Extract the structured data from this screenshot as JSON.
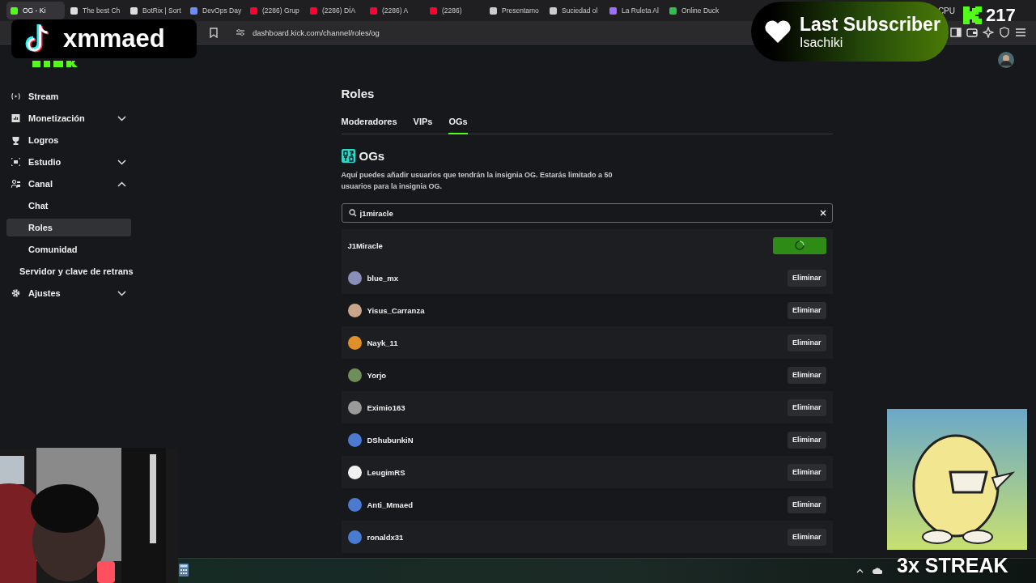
{
  "browser": {
    "tabs": [
      {
        "title": "OG - Ki",
        "selected": true,
        "color": "#53fc18"
      },
      {
        "title": "The best Ch",
        "selected": false,
        "color": "#dddddd"
      },
      {
        "title": "BotRix | Sort",
        "selected": false,
        "color": "#dddddd"
      },
      {
        "title": "DevOps Day",
        "selected": false,
        "color": "#6b8cff"
      },
      {
        "title": "(2286) Grup",
        "selected": false,
        "color": "#ff0033"
      },
      {
        "title": "(2286) DÍA",
        "selected": false,
        "color": "#ff0033"
      },
      {
        "title": "(2286) A",
        "selected": false,
        "color": "#ff0033"
      },
      {
        "title": "(2286)",
        "selected": false,
        "color": "#ff0033"
      },
      {
        "title": "Presentamo",
        "selected": false,
        "color": "#cccccc"
      },
      {
        "title": "Suciedad ol",
        "selected": false,
        "color": "#cccccc"
      },
      {
        "title": "La Ruleta Al",
        "selected": false,
        "color": "#a06bff"
      },
      {
        "title": "Online Duck",
        "selected": false,
        "color": "#2fbf4f"
      }
    ],
    "url": "dashboard.kick.com/channel/roles/og",
    "cpu": "CPU"
  },
  "sidebar": {
    "items": [
      {
        "label": "Stream",
        "kind": "link",
        "selected": false
      },
      {
        "label": "Monetización",
        "kind": "group",
        "expanded": false,
        "selected": false
      },
      {
        "label": "Logros",
        "kind": "link",
        "selected": false
      },
      {
        "label": "Estudio",
        "kind": "group",
        "expanded": false,
        "selected": false
      },
      {
        "label": "Canal",
        "kind": "group",
        "expanded": true,
        "selected": false,
        "children": [
          {
            "label": "Chat",
            "kind": "sub",
            "selected": false
          },
          {
            "label": "Roles",
            "kind": "sub",
            "selected": true
          },
          {
            "label": "Comunidad",
            "kind": "sub",
            "selected": false
          }
        ]
      },
      {
        "label": "Servidor y clave de retrans",
        "kind": "plain",
        "selected": false
      },
      {
        "label": "Ajustes",
        "kind": "group",
        "expanded": false,
        "selected": false
      }
    ]
  },
  "page": {
    "title": "Roles",
    "tabs": [
      {
        "label": "Moderadores",
        "selected": false
      },
      {
        "label": "VIPs",
        "selected": false
      },
      {
        "label": "OGs",
        "selected": true
      }
    ],
    "section_title": "OGs",
    "description": "Aquí puedes añadir usuarios que tendrán la insignia OG. Estarás limitado a 50 usuarios para la insignia OG.",
    "search": {
      "value": "j1miracle"
    },
    "result": {
      "name": "J1Miracle",
      "loading": true
    },
    "members": [
      {
        "name": "blue_mx",
        "color": "#8a8fb8",
        "action": "Eliminar"
      },
      {
        "name": "Yisus_Carranza",
        "color": "#c9a58a",
        "action": "Eliminar"
      },
      {
        "name": "Nayk_11",
        "color": "#e0902a",
        "action": "Eliminar"
      },
      {
        "name": "Yorjo",
        "color": "#6f8f5a",
        "action": "Eliminar"
      },
      {
        "name": "Eximio163",
        "color": "#9a9a9a",
        "action": "Eliminar"
      },
      {
        "name": "DShubunkiN",
        "color": "#4a7bd0",
        "action": "Eliminar"
      },
      {
        "name": "LeugimRS",
        "color": "#f2f2f2",
        "action": "Eliminar"
      },
      {
        "name": "Anti_Mmaed",
        "color": "#4a7bd0",
        "action": "Eliminar"
      },
      {
        "name": "ronaldx31",
        "color": "#4a7bd0",
        "action": "Eliminar"
      }
    ]
  },
  "overlays": {
    "tiktok_name": "xmmaed",
    "subscriber_title": "Last Subscriber",
    "subscriber_name": "Isachiki",
    "kick_count": "217",
    "streak": "3x STREAK"
  }
}
